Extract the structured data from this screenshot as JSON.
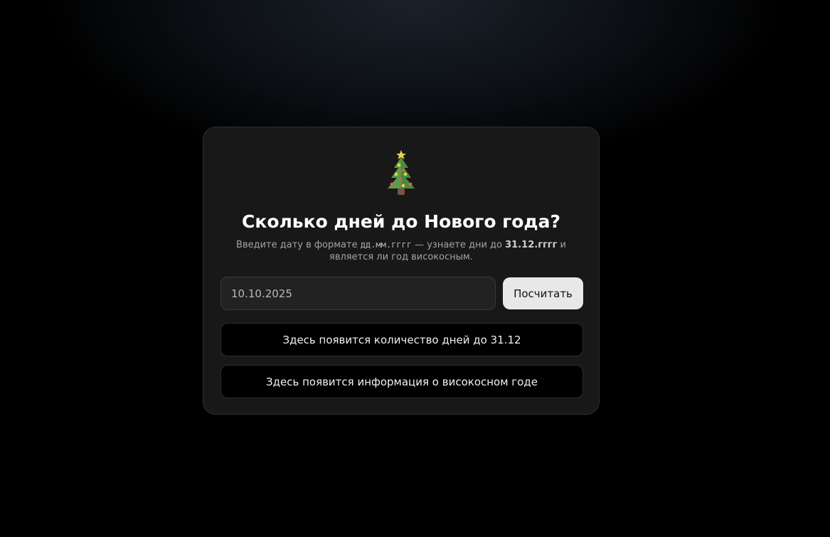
{
  "header": {
    "icon": "christmas-tree-icon",
    "title": "Сколько дней до Нового года?",
    "subtitle_part1": "Введите дату в формате ",
    "subtitle_format": "дд.мм.гггг",
    "subtitle_part2": " — узнаете дни до ",
    "subtitle_target": "31.12.гггг",
    "subtitle_part3": " и является ли год високосным."
  },
  "form": {
    "date_value": "10.10.2025",
    "submit_label": "Посчитать"
  },
  "results": {
    "days_text": "Здесь появится количество дней до 31.12",
    "leap_text": "Здесь появится информация о високосном годе"
  },
  "colors": {
    "card_background": "#181818",
    "button_background": "#e8e8e8",
    "result_background": "#000000"
  }
}
